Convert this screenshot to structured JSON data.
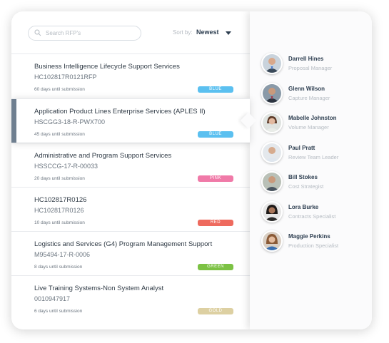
{
  "search": {
    "placeholder": "Search RFP's"
  },
  "sort": {
    "label": "Sort by:",
    "value": "Newest"
  },
  "rfps": [
    {
      "title": "Business Intelligence Lifecycle Support Services",
      "code": "HC102817R0121RFP",
      "days": "60 days until submission",
      "badge": "BLUE",
      "badge_color": "#5bc0f0"
    },
    {
      "title": "Application Product Lines Enterprise Services (APLES II)",
      "code": "HSCGG3-18-R-PWX700",
      "days": "45 days until submission",
      "badge": "BLUE",
      "badge_color": "#5bc0f0"
    },
    {
      "title": "Administrative and Program Support Services",
      "code": "HSSCCG-17-R-00033",
      "days": "20 days until submission",
      "badge": "PINK",
      "badge_color": "#f07aa8"
    },
    {
      "title": "HC102817R0126",
      "code": "HC102817R0126",
      "days": "10 days until submission",
      "badge": "RED",
      "badge_color": "#ee6a5e"
    },
    {
      "title": "Logistics and Services (G4) Program Management Support",
      "code": "M95494-17-R-0006",
      "days": "8 days until submission",
      "badge": "GREEN",
      "badge_color": "#7cc244"
    },
    {
      "title": "Live Training Systems-Non System Analyst",
      "code": "0010947917",
      "days": "6 days until submission",
      "badge": "GOLD",
      "badge_color": "#ddd0a2"
    }
  ],
  "team": [
    {
      "name": "Darrell Hines",
      "role": "Proposal Manager"
    },
    {
      "name": "Glenn Wilson",
      "role": "Capture Manager"
    },
    {
      "name": "Mabelle Johnston",
      "role": "Volume Manager"
    },
    {
      "name": "Paul Pratt",
      "role": "Review Team Leader"
    },
    {
      "name": "Bill Stokes",
      "role": "Cost Strategist"
    },
    {
      "name": "Lora Burke",
      "role": "Contracts Specialist"
    },
    {
      "name": "Maggie Perkins",
      "role": "Production Specialist"
    }
  ],
  "colors": {
    "accent_bar": "#6f7f90",
    "title_text": "#2d3e50",
    "muted_text": "#b5bbc2"
  }
}
